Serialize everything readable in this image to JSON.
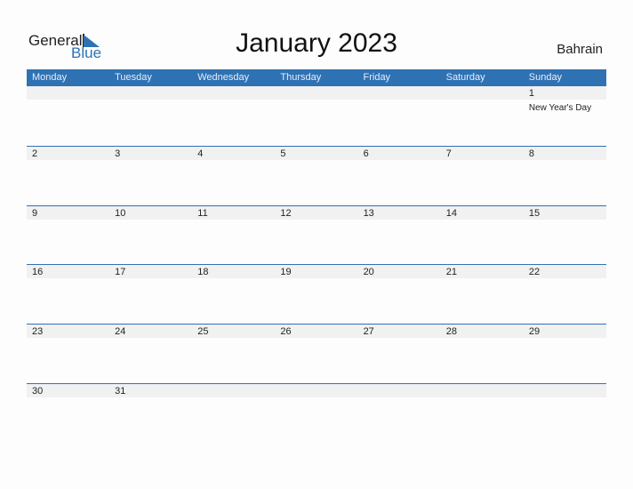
{
  "brand": {
    "word1": "General",
    "word2": "Blue"
  },
  "title": "January 2023",
  "country": "Bahrain",
  "colors": {
    "accent": "#2f72b4",
    "band": "#f1f1f1"
  },
  "weekdays": [
    "Monday",
    "Tuesday",
    "Wednesday",
    "Thursday",
    "Friday",
    "Saturday",
    "Sunday"
  ],
  "weeks": [
    [
      {
        "day": ""
      },
      {
        "day": ""
      },
      {
        "day": ""
      },
      {
        "day": ""
      },
      {
        "day": ""
      },
      {
        "day": ""
      },
      {
        "day": "1",
        "holiday": "New Year's Day"
      }
    ],
    [
      {
        "day": "2"
      },
      {
        "day": "3"
      },
      {
        "day": "4"
      },
      {
        "day": "5"
      },
      {
        "day": "6"
      },
      {
        "day": "7"
      },
      {
        "day": "8"
      }
    ],
    [
      {
        "day": "9"
      },
      {
        "day": "10"
      },
      {
        "day": "11"
      },
      {
        "day": "12"
      },
      {
        "day": "13"
      },
      {
        "day": "14"
      },
      {
        "day": "15"
      }
    ],
    [
      {
        "day": "16"
      },
      {
        "day": "17"
      },
      {
        "day": "18"
      },
      {
        "day": "19"
      },
      {
        "day": "20"
      },
      {
        "day": "21"
      },
      {
        "day": "22"
      }
    ],
    [
      {
        "day": "23"
      },
      {
        "day": "24"
      },
      {
        "day": "25"
      },
      {
        "day": "26"
      },
      {
        "day": "27"
      },
      {
        "day": "28"
      },
      {
        "day": "29"
      }
    ],
    [
      {
        "day": "30"
      },
      {
        "day": "31"
      },
      {
        "day": ""
      },
      {
        "day": ""
      },
      {
        "day": ""
      },
      {
        "day": ""
      },
      {
        "day": ""
      }
    ]
  ]
}
